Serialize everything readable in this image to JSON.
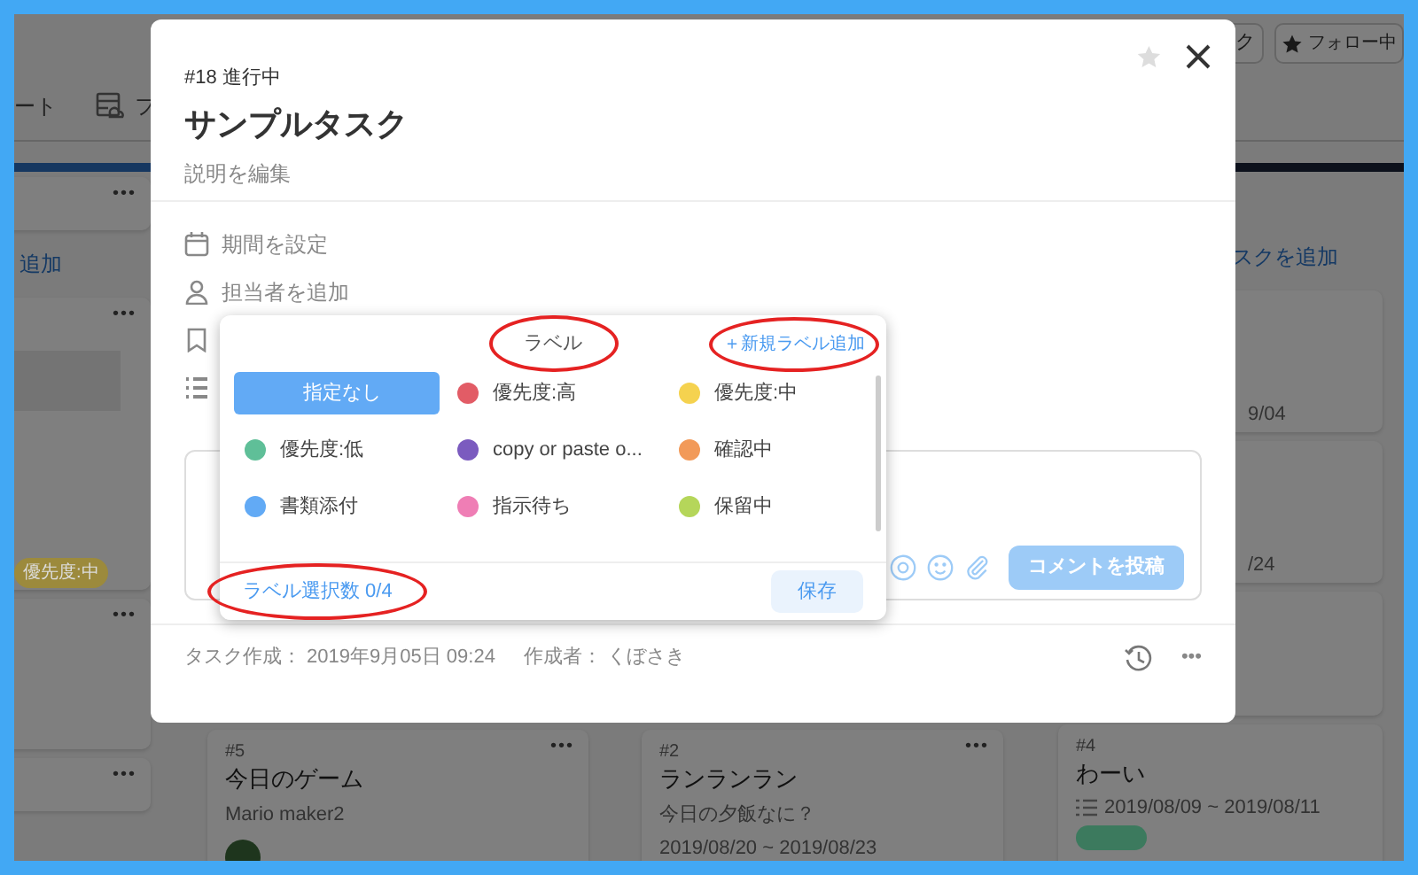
{
  "board": {
    "header_buttons": [
      {
        "label": "ク",
        "kind": "plain"
      },
      {
        "label": "フォロー中",
        "kind": "star"
      }
    ],
    "tabs": [
      {
        "label": "ート",
        "kind": "text"
      },
      {
        "label": "フ",
        "kind": "icon"
      }
    ],
    "columns": [
      {
        "items": [
          {
            "kind": "card",
            "menu": "•••"
          },
          {
            "kind": "add",
            "label": "追加"
          },
          {
            "kind": "card",
            "menu": "•••",
            "thumbnail": true,
            "tag": {
              "label": "優先度:中",
              "color": "#9c8a3c"
            }
          },
          {
            "kind": "card",
            "menu": "•••"
          },
          {
            "kind": "card",
            "menu": "•••"
          }
        ]
      },
      {
        "items": [
          {
            "kind": "card",
            "menu": "•••",
            "number": "#5",
            "title": "今日のゲーム",
            "description": "Mario maker2",
            "avatar": true
          }
        ]
      },
      {
        "items": [
          {
            "kind": "card",
            "menu": "•••",
            "number": "#2",
            "title": "ランランラン",
            "description": "今日の夕飯なに？",
            "dates": "2019/08/20 ~ 2019/08/23"
          }
        ]
      },
      {
        "items": [
          {
            "kind": "add",
            "label": "スクを追加"
          },
          {
            "kind": "card",
            "dates": "9/04"
          },
          {
            "kind": "card",
            "dates": "/24"
          },
          {
            "kind": "card"
          },
          {
            "kind": "card",
            "number": "#4",
            "title": "わーい",
            "dates": "2019/08/09 ~ 2019/08/11",
            "date_icon": true,
            "tag": {
              "color": "#3c7a5e"
            }
          }
        ]
      }
    ]
  },
  "modal": {
    "status": "#18 進行中",
    "title": "サンプルタスク",
    "description_link": "説明を編集",
    "starred": false,
    "fields": [
      {
        "kind": "calendar",
        "label": "期間を設定"
      },
      {
        "kind": "person",
        "label": "担当者を追加"
      },
      {
        "kind": "bookmark"
      },
      {
        "kind": "list"
      }
    ],
    "comment": {
      "button": "コメントを投稿",
      "disabled": true
    },
    "footer": {
      "created": "タスク作成： 2019年9月05日 09:24",
      "author": "作成者： くぼさき",
      "menu": "•••"
    }
  },
  "label_picker": {
    "title": {
      "text": "ラベル",
      "circled": true
    },
    "add_link": {
      "text": "＋新規ラベル追加",
      "circled": true
    },
    "options": [
      {
        "label": "指定なし",
        "kind": "none",
        "selected": true
      },
      {
        "label": "優先度:高",
        "kind": "color",
        "color": "#e25c66",
        "selected": false
      },
      {
        "label": "優先度:中",
        "kind": "color",
        "color": "#f5d24f",
        "selected": false
      },
      {
        "label": "優先度:低",
        "kind": "color",
        "color": "#5fbf98",
        "selected": false
      },
      {
        "label": "copy or paste o...",
        "kind": "color",
        "color": "#7b5bbf",
        "selected": false
      },
      {
        "label": "確認中",
        "kind": "color",
        "color": "#f29a59",
        "selected": false
      },
      {
        "label": "書類添付",
        "kind": "color",
        "color": "#62aaf5",
        "selected": false
      },
      {
        "label": "指示待ち",
        "kind": "color",
        "color": "#ef7eb5",
        "selected": false
      },
      {
        "label": "保留中",
        "kind": "color",
        "color": "#b5d65a",
        "selected": false
      }
    ],
    "counter": {
      "text": "ラベル選択数 0/4",
      "circled": true
    },
    "save_button": "保存"
  }
}
